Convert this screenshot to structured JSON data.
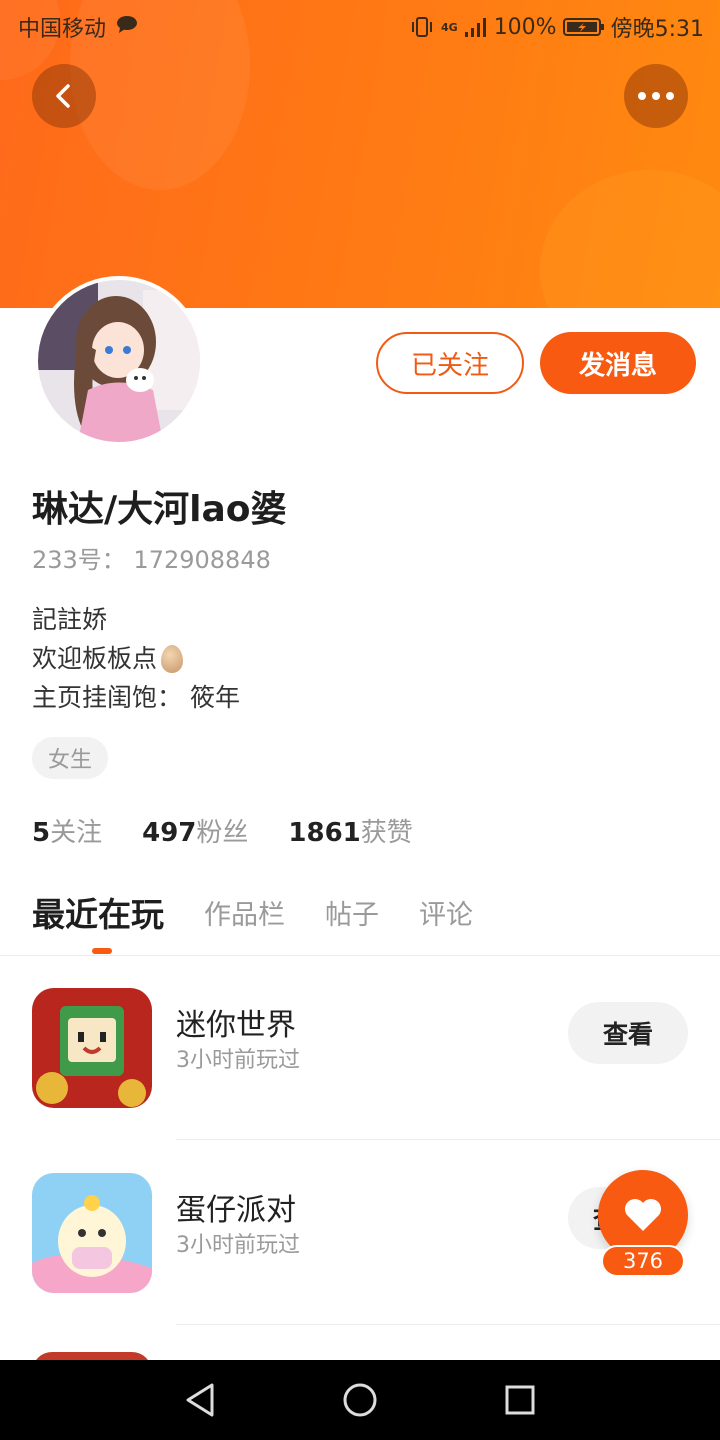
{
  "status_bar": {
    "carrier": "中国移动",
    "network": "4G",
    "battery": "100%",
    "time": "傍晚5:31"
  },
  "profile": {
    "name": "琳达/大河lao婆",
    "uid": "233号： 172908848",
    "bio": [
      "記註娇",
      "欢迎板板点",
      "主页挂闺饱： 筱年"
    ],
    "tag": "女生",
    "follow_button": "已关注",
    "message_button": "发消息"
  },
  "stats": [
    {
      "num": "5",
      "label": "关注"
    },
    {
      "num": "497",
      "label": "粉丝"
    },
    {
      "num": "1861",
      "label": "获赞"
    }
  ],
  "tabs": [
    {
      "label": "最近在玩",
      "active": true
    },
    {
      "label": "作品栏",
      "active": false
    },
    {
      "label": "帖子",
      "active": false
    },
    {
      "label": "评论",
      "active": false
    }
  ],
  "games": [
    {
      "title": "迷你世界",
      "sub": "3小时前玩过",
      "action": "查看"
    },
    {
      "title": "蛋仔派对",
      "sub": "3小时前玩过",
      "action": "查看"
    }
  ],
  "like": {
    "count": "376"
  },
  "colors": {
    "accent": "#f75a10",
    "banner": "#ff7a14"
  }
}
